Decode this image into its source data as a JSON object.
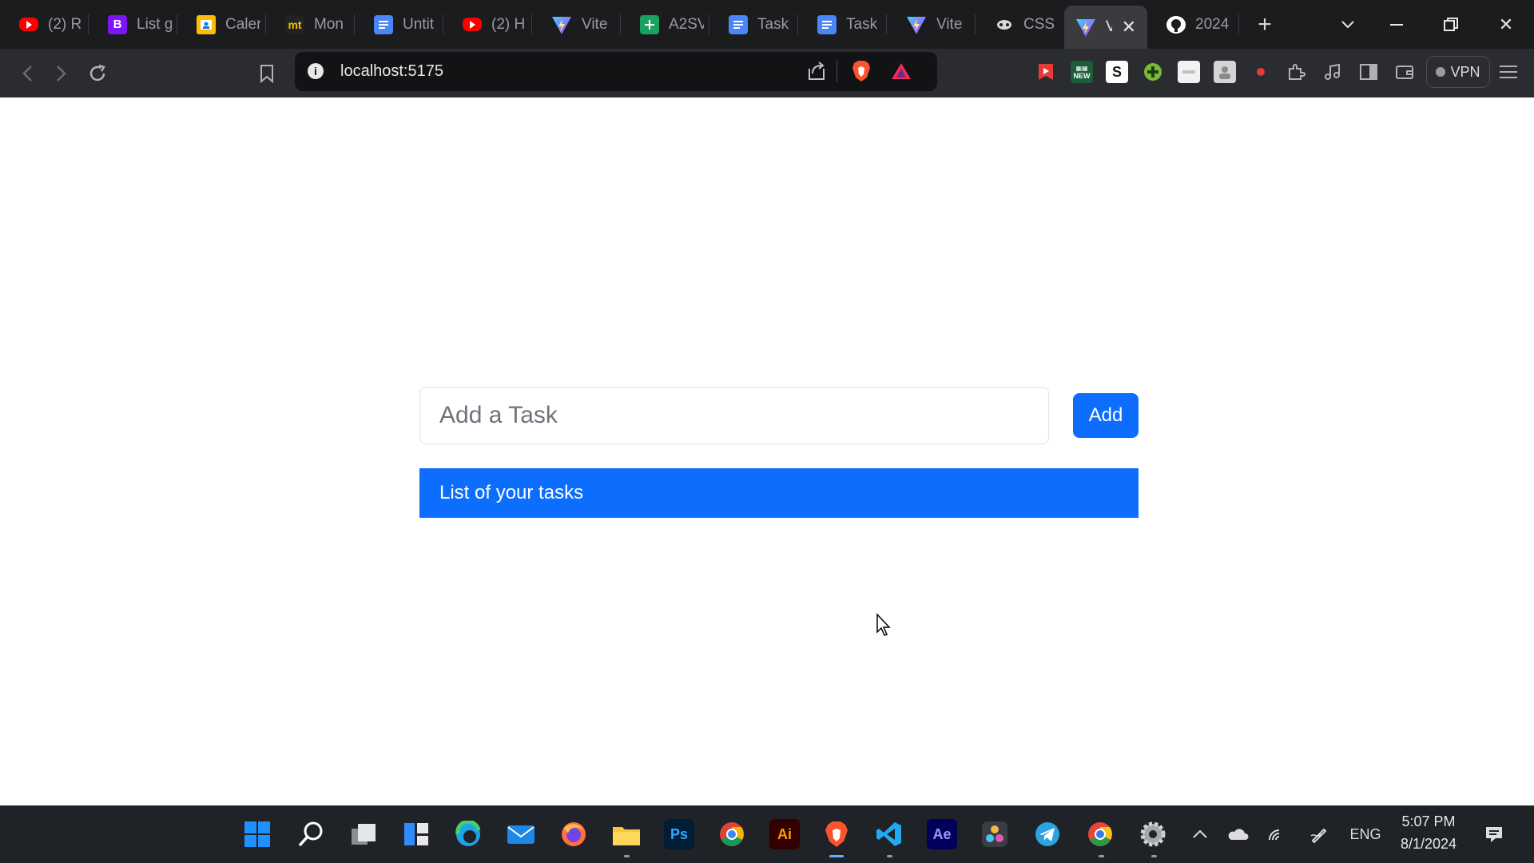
{
  "browser": {
    "tabs": [
      {
        "icon": "youtube-icon",
        "label": "(2) R"
      },
      {
        "icon": "bootstrap-icon",
        "label": "List g"
      },
      {
        "icon": "calendar-icon",
        "label": "Caler"
      },
      {
        "icon": "monkeytype-icon",
        "label": "Mon"
      },
      {
        "icon": "docs-icon",
        "label": "Untit"
      },
      {
        "icon": "youtube-icon",
        "label": "(2) H"
      },
      {
        "icon": "vite-icon",
        "label": "Vite"
      },
      {
        "icon": "sheets-icon",
        "label": "A2SV"
      },
      {
        "icon": "docs-icon",
        "label": "Task"
      },
      {
        "icon": "docs-icon",
        "label": "Task"
      },
      {
        "icon": "vite-icon",
        "label": "Vite"
      },
      {
        "icon": "css-icon",
        "label": "CSS"
      },
      {
        "icon": "vite-icon",
        "label": "V",
        "active": true
      },
      {
        "icon": "github-icon",
        "label": "2024"
      }
    ],
    "url": "localhost:5175",
    "vpn_label": "VPN",
    "ext_new_label": "NEW",
    "ext_s_label": "S",
    "fav_b": "B",
    "fav_mt": "mt"
  },
  "app": {
    "input_placeholder": "Add a Task",
    "add_button_label": "Add",
    "list_header": "List of your tasks"
  },
  "taskbar": {
    "ps_label": "Ps",
    "ai_label": "Ai",
    "ae_label": "Ae",
    "language": "ENG",
    "time": "5:07 PM",
    "date": "8/1/2024"
  },
  "colors": {
    "primary": "#0d6efd",
    "tab_strip": "#1b1c1e",
    "toolbar": "#2b2c30",
    "taskbar": "#1f2226"
  }
}
